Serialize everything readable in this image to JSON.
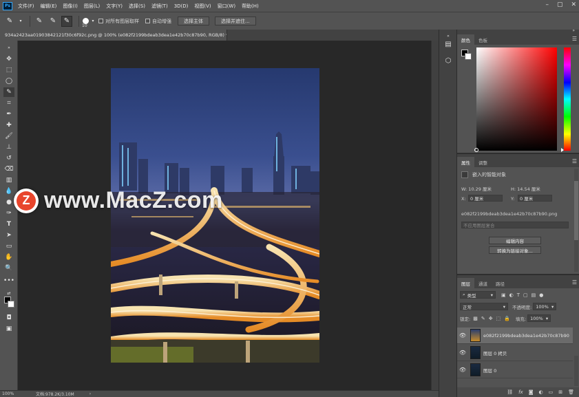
{
  "menu": {
    "logo": "Ps",
    "items": [
      "文件(F)",
      "编辑(E)",
      "图像(I)",
      "图层(L)",
      "文字(Y)",
      "选择(S)",
      "滤镜(T)",
      "3D(D)",
      "视图(V)",
      "窗口(W)",
      "帮助(H)"
    ]
  },
  "options": {
    "brush_size": "10",
    "sample_all_label": "对所有图层取样",
    "auto_enhance_label": "自动增强",
    "select_subject_label": "选择主体",
    "select_mask_label": "选择并遮住..."
  },
  "document": {
    "tab_title": "934a2423aa01903842121f30c6f92c.png @ 100% (e082f2199bdeab3dea1e42b70c87b90, RGB/8) *",
    "close_label": "×"
  },
  "status": {
    "zoom": "100%",
    "doc_size": "文档:978.2K/3.10M",
    "arrow": "›"
  },
  "watermark": {
    "letter": "Z",
    "text": "www.MacZ.com"
  },
  "color_panel": {
    "tabs": [
      "颜色",
      "色板"
    ]
  },
  "properties": {
    "tabs": [
      "属性",
      "调整"
    ],
    "type_label": "嵌入的智能对象",
    "w": "W: 10.29 厘米",
    "h": "H: 14.54 厘米",
    "x_label": "X:",
    "x_value": "0 厘米",
    "y_label": "Y:",
    "y_value": "0 厘米",
    "filename": "e082f2199bdeab3dea1e42b70c87b90.png",
    "comp_placeholder": "不应用图层复合",
    "edit_button": "编辑内容",
    "convert_button": "转换为链接对象..."
  },
  "layers": {
    "tabs": [
      "图层",
      "通道",
      "路径"
    ],
    "filter_kind": "类型",
    "blend_mode": "正常",
    "opacity_label": "不透明度:",
    "opacity_value": "100%",
    "lock_label": "锁定:",
    "fill_label": "填充:",
    "fill_value": "100%",
    "items": [
      {
        "name": "e082f2199bdeab3dea1e42b70c87b90"
      },
      {
        "name": "图层 0 拷贝"
      },
      {
        "name": "图层 0"
      }
    ]
  }
}
